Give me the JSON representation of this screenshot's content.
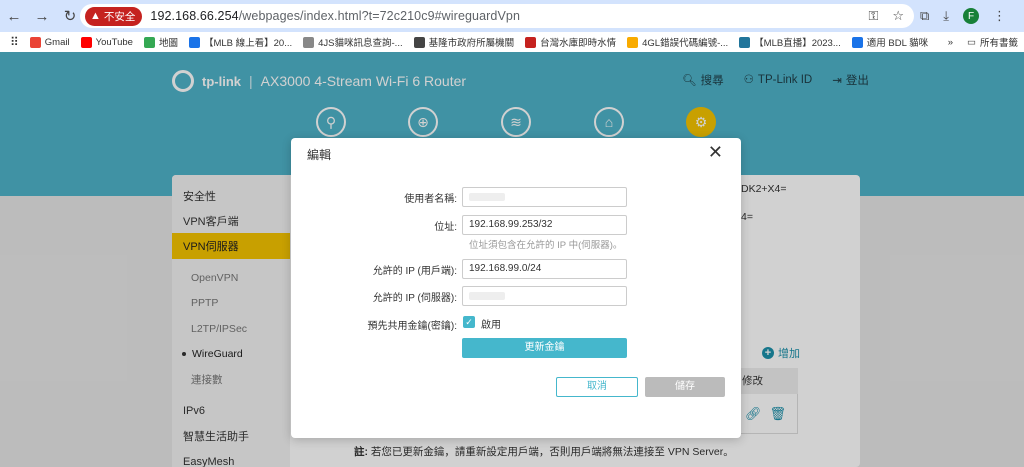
{
  "browser": {
    "insecure_label": "不安全",
    "url_host": "192.168.66.254",
    "url_path": "/webpages/index.html?t=72c210c9#wireguardVpn",
    "avatar_letter": "F",
    "bookmarks": [
      {
        "label": "Gmail",
        "color": "#ea4335"
      },
      {
        "label": "YouTube",
        "color": "#ff0000"
      },
      {
        "label": "地圖",
        "color": "#34a853"
      },
      {
        "label": "【MLB 線上看】20...",
        "color": "#1a73e8"
      },
      {
        "label": "4JS貓咪訊息查詢-...",
        "color": "#888888"
      },
      {
        "label": "基隆市政府所屬機關",
        "color": "#444444"
      },
      {
        "label": "台灣水庫即時水情",
        "color": "#c5221f"
      },
      {
        "label": "4GL錯誤代碼編號-...",
        "color": "#f9ab00"
      },
      {
        "label": "【MLB直播】2023...",
        "color": "#21759b"
      },
      {
        "label": "適用 BDL 貓咪",
        "color": "#1a73e8"
      }
    ],
    "more_bookmarks": "所有書籤"
  },
  "router": {
    "brand": "tp-link",
    "model": "AX3000 4-Stream Wi-Fi 6 Router",
    "search": "搜尋",
    "tplink_id": "TP-Link ID",
    "logout": "登出",
    "sidebar": [
      {
        "label": "安全性"
      },
      {
        "label": "VPN客戶端"
      },
      {
        "label": "VPN伺服器"
      },
      {
        "label": "OpenVPN"
      },
      {
        "label": "PPTP"
      },
      {
        "label": "L2TP/IPSec"
      },
      {
        "label": "WireGuard"
      },
      {
        "label": "連接數"
      },
      {
        "label": "IPv6"
      },
      {
        "label": "智慧生活助手"
      },
      {
        "label": "EasyMesh"
      }
    ],
    "bg_text_1": "DK2+X4=",
    "bg_text_2": "4=",
    "add_label": "增加",
    "modify_col": "修改",
    "note_prefix": "註:",
    "note_text": "若您已更新金鑰，請重新設定用戶端，否則用戶端將無法連接至 VPN Server。"
  },
  "modal": {
    "title": "編輯",
    "username_label": "使用者名稱:",
    "address_label": "位址:",
    "address_value": "192.168.99.253/32",
    "address_hint": "位址須包含在允許的 IP 中(伺服器)。",
    "allowed_client_label": "允許的 IP (用戶端):",
    "allowed_client_value": "192.168.99.0/24",
    "allowed_server_label": "允許的 IP (伺服器):",
    "psk_label": "預先共用金鑰(密鑰):",
    "psk_enabled_label": "啟用",
    "update_key": "更新金鑰",
    "cancel": "取消",
    "save": "儲存"
  }
}
